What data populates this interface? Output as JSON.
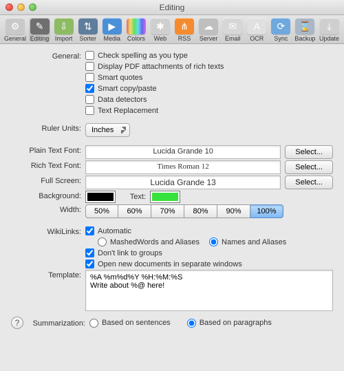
{
  "window": {
    "title": "Editing"
  },
  "toolbar": [
    {
      "label": "General",
      "bg": "#c9c9c9",
      "glyph": "⚙"
    },
    {
      "label": "Editing",
      "bg": "#6f6f6f",
      "glyph": "✎",
      "selected": true
    },
    {
      "label": "Import",
      "bg": "#8dbb63",
      "glyph": "⇩"
    },
    {
      "label": "Sorter",
      "bg": "#5f7d9c",
      "glyph": "⇅"
    },
    {
      "label": "Media",
      "bg": "#4a90d9",
      "glyph": "▶"
    },
    {
      "label": "Colors",
      "bg": "linear-gradient(90deg,#e66,#ed6,#6d6,#6de,#66e,#d6e)",
      "glyph": ""
    },
    {
      "label": "Web",
      "bg": "#cfcfcf",
      "glyph": "✱"
    },
    {
      "label": "RSS",
      "bg": "#f58b2e",
      "glyph": "⋔"
    },
    {
      "label": "Server",
      "bg": "#bfbfbf",
      "glyph": "☁"
    },
    {
      "label": "Email",
      "bg": "#d7d7d7",
      "glyph": "✉"
    },
    {
      "label": "OCR",
      "bg": "#e0e0e0",
      "glyph": "A"
    },
    {
      "label": "Sync",
      "bg": "#6fa8dc",
      "glyph": "⟳"
    },
    {
      "label": "Backup",
      "bg": "#a9b7c6",
      "glyph": "⌛"
    },
    {
      "label": "Update",
      "bg": "#cfcfcf",
      "glyph": "⤓"
    }
  ],
  "labels": {
    "general": "General:",
    "rulerUnits": "Ruler Units:",
    "plainTextFont": "Plain Text Font:",
    "richTextFont": "Rich Text Font:",
    "fullScreen": "Full Screen:",
    "background": "Background:",
    "text": "Text:",
    "width": "Width:",
    "wikiLinks": "WikiLinks:",
    "template": "Template:",
    "summarization": "Summarization:"
  },
  "general": {
    "options": [
      {
        "label": "Check spelling as you type",
        "checked": false
      },
      {
        "label": "Display PDF attachments of rich texts",
        "checked": false
      },
      {
        "label": "Smart quotes",
        "checked": false
      },
      {
        "label": "Smart copy/paste",
        "checked": true
      },
      {
        "label": "Data detectors",
        "checked": false
      },
      {
        "label": "Text Replacement",
        "checked": false
      }
    ]
  },
  "rulerUnits": {
    "value": "Inches"
  },
  "fonts": {
    "plain": "Lucida Grande 10",
    "rich": "Times Roman 12",
    "full": "Lucida Grande 13",
    "selectLabel": "Select..."
  },
  "colors": {
    "background": "#000000",
    "text": "#37e23c"
  },
  "width": {
    "options": [
      "50%",
      "60%",
      "70%",
      "80%",
      "90%",
      "100%"
    ],
    "selected": "100%"
  },
  "wiki": {
    "automatic": {
      "label": "Automatic",
      "checked": true
    },
    "mode": {
      "options": [
        "MashedWords and Aliases",
        "Names and Aliases"
      ],
      "selected": "Names and Aliases"
    },
    "dontLink": {
      "label": "Don't link to groups",
      "checked": true
    },
    "openNew": {
      "label": "Open new documents in separate windows",
      "checked": true
    }
  },
  "template": {
    "value": "%A %m%d%Y %H:%M:%S\nWrite about %@ here!"
  },
  "summarization": {
    "options": [
      "Based on sentences",
      "Based on paragraphs"
    ],
    "selected": "Based on paragraphs"
  }
}
